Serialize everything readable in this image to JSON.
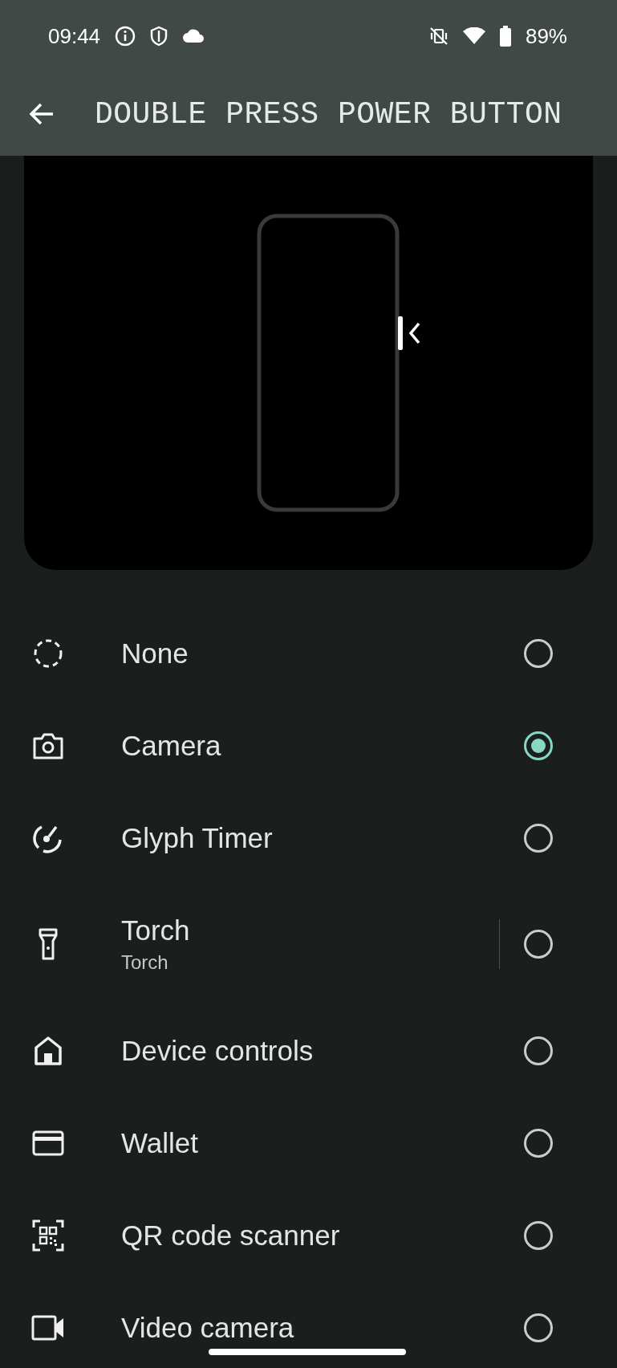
{
  "status_bar": {
    "time": "09:44",
    "battery": "89%"
  },
  "header": {
    "title": "DOUBLE PRESS POWER BUTTON"
  },
  "options": [
    {
      "kind": "none",
      "label": "None",
      "selected": false
    },
    {
      "kind": "camera",
      "label": "Camera",
      "selected": true
    },
    {
      "kind": "timer",
      "label": "Glyph Timer",
      "selected": false
    },
    {
      "kind": "torch",
      "label": "Torch",
      "sublabel": "Torch",
      "selected": false
    },
    {
      "kind": "home",
      "label": "Device controls",
      "selected": false
    },
    {
      "kind": "wallet",
      "label": "Wallet",
      "selected": false
    },
    {
      "kind": "qr",
      "label": "QR code scanner",
      "selected": false
    },
    {
      "kind": "video",
      "label": "Video camera",
      "selected": false
    }
  ]
}
